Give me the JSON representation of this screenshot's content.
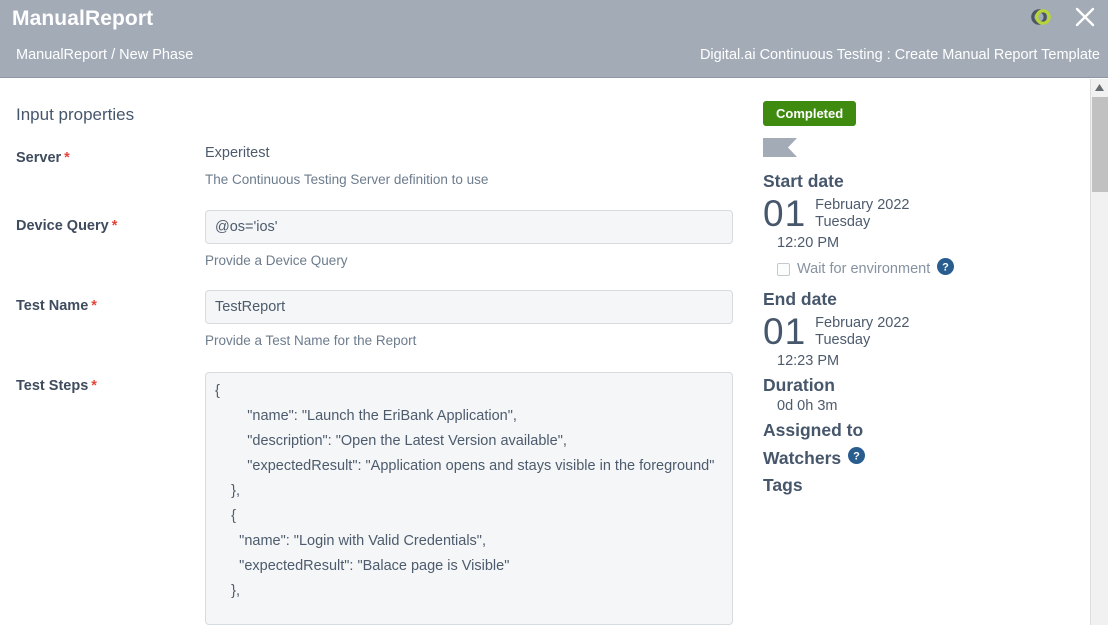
{
  "header": {
    "app_title": "ManualReport",
    "breadcrumb": "ManualReport / New Phase",
    "context_title": "Digital.ai Continuous Testing : Create Manual Report Template",
    "brand_icon": "digital-ai-logo-icon",
    "close_icon": "close-icon",
    "bar_color": "#a3abb7"
  },
  "main": {
    "section_title": "Input properties",
    "fields": [
      {
        "label": "Server",
        "required": "*",
        "value": "Experitest",
        "helper": "The Continuous Testing Server definition to use",
        "kind": "static"
      },
      {
        "label": "Device Query",
        "required": "*",
        "value": "@os='ios'",
        "placeholder": "",
        "helper": "Provide a Device Query",
        "kind": "input"
      },
      {
        "label": "Test Name",
        "required": "*",
        "value": "TestReport",
        "placeholder": "",
        "helper": "Provide a Test Name for the Report",
        "kind": "input"
      },
      {
        "label": "Test Steps",
        "required": "*",
        "value": "{\n        \"name\": \"Launch the EriBank Application\",\n        \"description\": \"Open the Latest Version available\",\n        \"expectedResult\": \"Application opens and stays visible in the foreground\"\n    },\n    {\n      \"name\": \"Login with Valid Credentials\",\n      \"expectedResult\": \"Balace page is Visible\"\n    },",
        "placeholder": "",
        "helper": "",
        "kind": "textarea"
      }
    ]
  },
  "right_panel": {
    "status": "Completed",
    "status_color": "#3f8b10",
    "flag_icon": "flag-icon",
    "start": {
      "heading": "Start date",
      "day": "01",
      "month_year": "February 2022",
      "weekday": "Tuesday",
      "time": "12:20 PM"
    },
    "wait_for_environment": {
      "label": "Wait for environment",
      "checked": false,
      "help_icon": "help-circle-icon"
    },
    "end": {
      "heading": "End date",
      "day": "01",
      "month_year": "February 2022",
      "weekday": "Tuesday",
      "time": "12:23 PM"
    },
    "duration": {
      "heading": "Duration",
      "value": "0d 0h 3m"
    },
    "assigned_to": "Assigned to",
    "watchers": {
      "label": "Watchers",
      "help_icon": "help-circle-icon"
    },
    "tags": "Tags"
  },
  "scrollbar": {
    "up_arrow_icon": "scroll-up-arrow-icon",
    "thumb": "scroll-thumb"
  }
}
